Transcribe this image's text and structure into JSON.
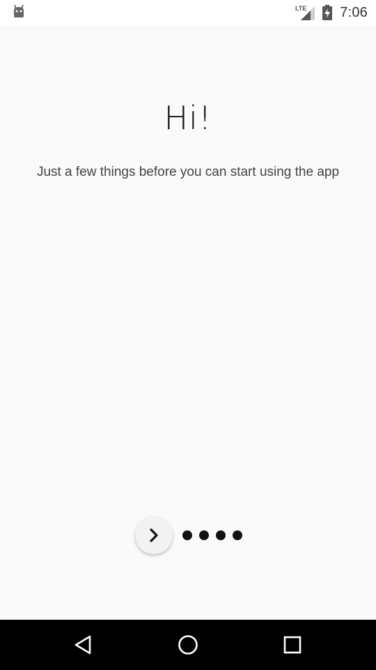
{
  "status_bar": {
    "time": "7:06",
    "network_label": "LTE",
    "icons": [
      "android-debug-icon",
      "lte-signal-icon",
      "battery-charging-icon"
    ]
  },
  "intro": {
    "title": "Hi!",
    "subtitle": "Just a few things before you can start using the app"
  },
  "pager": {
    "next_icon": "chevron-right-icon",
    "page_count": 4
  },
  "nav_bar": {
    "buttons": [
      "back-icon",
      "home-icon",
      "recents-icon"
    ]
  },
  "colors": {
    "background": "#fafafa",
    "text_primary": "#111111",
    "text_secondary": "#444444",
    "nav_bar": "#000000"
  }
}
